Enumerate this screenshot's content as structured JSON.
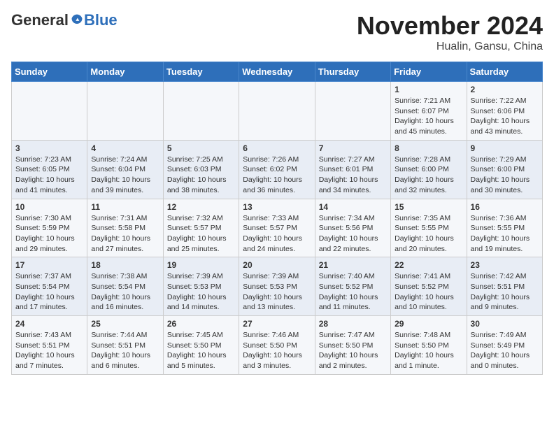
{
  "header": {
    "logo_general": "General",
    "logo_blue": "Blue",
    "month_title": "November 2024",
    "subtitle": "Hualin, Gansu, China"
  },
  "weekdays": [
    "Sunday",
    "Monday",
    "Tuesday",
    "Wednesday",
    "Thursday",
    "Friday",
    "Saturday"
  ],
  "weeks": [
    [
      {
        "day": "",
        "sunrise": "",
        "sunset": "",
        "daylight": ""
      },
      {
        "day": "",
        "sunrise": "",
        "sunset": "",
        "daylight": ""
      },
      {
        "day": "",
        "sunrise": "",
        "sunset": "",
        "daylight": ""
      },
      {
        "day": "",
        "sunrise": "",
        "sunset": "",
        "daylight": ""
      },
      {
        "day": "",
        "sunrise": "",
        "sunset": "",
        "daylight": ""
      },
      {
        "day": "1",
        "sunrise": "Sunrise: 7:21 AM",
        "sunset": "Sunset: 6:07 PM",
        "daylight": "Daylight: 10 hours and 45 minutes."
      },
      {
        "day": "2",
        "sunrise": "Sunrise: 7:22 AM",
        "sunset": "Sunset: 6:06 PM",
        "daylight": "Daylight: 10 hours and 43 minutes."
      }
    ],
    [
      {
        "day": "3",
        "sunrise": "Sunrise: 7:23 AM",
        "sunset": "Sunset: 6:05 PM",
        "daylight": "Daylight: 10 hours and 41 minutes."
      },
      {
        "day": "4",
        "sunrise": "Sunrise: 7:24 AM",
        "sunset": "Sunset: 6:04 PM",
        "daylight": "Daylight: 10 hours and 39 minutes."
      },
      {
        "day": "5",
        "sunrise": "Sunrise: 7:25 AM",
        "sunset": "Sunset: 6:03 PM",
        "daylight": "Daylight: 10 hours and 38 minutes."
      },
      {
        "day": "6",
        "sunrise": "Sunrise: 7:26 AM",
        "sunset": "Sunset: 6:02 PM",
        "daylight": "Daylight: 10 hours and 36 minutes."
      },
      {
        "day": "7",
        "sunrise": "Sunrise: 7:27 AM",
        "sunset": "Sunset: 6:01 PM",
        "daylight": "Daylight: 10 hours and 34 minutes."
      },
      {
        "day": "8",
        "sunrise": "Sunrise: 7:28 AM",
        "sunset": "Sunset: 6:00 PM",
        "daylight": "Daylight: 10 hours and 32 minutes."
      },
      {
        "day": "9",
        "sunrise": "Sunrise: 7:29 AM",
        "sunset": "Sunset: 6:00 PM",
        "daylight": "Daylight: 10 hours and 30 minutes."
      }
    ],
    [
      {
        "day": "10",
        "sunrise": "Sunrise: 7:30 AM",
        "sunset": "Sunset: 5:59 PM",
        "daylight": "Daylight: 10 hours and 29 minutes."
      },
      {
        "day": "11",
        "sunrise": "Sunrise: 7:31 AM",
        "sunset": "Sunset: 5:58 PM",
        "daylight": "Daylight: 10 hours and 27 minutes."
      },
      {
        "day": "12",
        "sunrise": "Sunrise: 7:32 AM",
        "sunset": "Sunset: 5:57 PM",
        "daylight": "Daylight: 10 hours and 25 minutes."
      },
      {
        "day": "13",
        "sunrise": "Sunrise: 7:33 AM",
        "sunset": "Sunset: 5:57 PM",
        "daylight": "Daylight: 10 hours and 24 minutes."
      },
      {
        "day": "14",
        "sunrise": "Sunrise: 7:34 AM",
        "sunset": "Sunset: 5:56 PM",
        "daylight": "Daylight: 10 hours and 22 minutes."
      },
      {
        "day": "15",
        "sunrise": "Sunrise: 7:35 AM",
        "sunset": "Sunset: 5:55 PM",
        "daylight": "Daylight: 10 hours and 20 minutes."
      },
      {
        "day": "16",
        "sunrise": "Sunrise: 7:36 AM",
        "sunset": "Sunset: 5:55 PM",
        "daylight": "Daylight: 10 hours and 19 minutes."
      }
    ],
    [
      {
        "day": "17",
        "sunrise": "Sunrise: 7:37 AM",
        "sunset": "Sunset: 5:54 PM",
        "daylight": "Daylight: 10 hours and 17 minutes."
      },
      {
        "day": "18",
        "sunrise": "Sunrise: 7:38 AM",
        "sunset": "Sunset: 5:54 PM",
        "daylight": "Daylight: 10 hours and 16 minutes."
      },
      {
        "day": "19",
        "sunrise": "Sunrise: 7:39 AM",
        "sunset": "Sunset: 5:53 PM",
        "daylight": "Daylight: 10 hours and 14 minutes."
      },
      {
        "day": "20",
        "sunrise": "Sunrise: 7:39 AM",
        "sunset": "Sunset: 5:53 PM",
        "daylight": "Daylight: 10 hours and 13 minutes."
      },
      {
        "day": "21",
        "sunrise": "Sunrise: 7:40 AM",
        "sunset": "Sunset: 5:52 PM",
        "daylight": "Daylight: 10 hours and 11 minutes."
      },
      {
        "day": "22",
        "sunrise": "Sunrise: 7:41 AM",
        "sunset": "Sunset: 5:52 PM",
        "daylight": "Daylight: 10 hours and 10 minutes."
      },
      {
        "day": "23",
        "sunrise": "Sunrise: 7:42 AM",
        "sunset": "Sunset: 5:51 PM",
        "daylight": "Daylight: 10 hours and 9 minutes."
      }
    ],
    [
      {
        "day": "24",
        "sunrise": "Sunrise: 7:43 AM",
        "sunset": "Sunset: 5:51 PM",
        "daylight": "Daylight: 10 hours and 7 minutes."
      },
      {
        "day": "25",
        "sunrise": "Sunrise: 7:44 AM",
        "sunset": "Sunset: 5:51 PM",
        "daylight": "Daylight: 10 hours and 6 minutes."
      },
      {
        "day": "26",
        "sunrise": "Sunrise: 7:45 AM",
        "sunset": "Sunset: 5:50 PM",
        "daylight": "Daylight: 10 hours and 5 minutes."
      },
      {
        "day": "27",
        "sunrise": "Sunrise: 7:46 AM",
        "sunset": "Sunset: 5:50 PM",
        "daylight": "Daylight: 10 hours and 3 minutes."
      },
      {
        "day": "28",
        "sunrise": "Sunrise: 7:47 AM",
        "sunset": "Sunset: 5:50 PM",
        "daylight": "Daylight: 10 hours and 2 minutes."
      },
      {
        "day": "29",
        "sunrise": "Sunrise: 7:48 AM",
        "sunset": "Sunset: 5:50 PM",
        "daylight": "Daylight: 10 hours and 1 minute."
      },
      {
        "day": "30",
        "sunrise": "Sunrise: 7:49 AM",
        "sunset": "Sunset: 5:49 PM",
        "daylight": "Daylight: 10 hours and 0 minutes."
      }
    ]
  ]
}
